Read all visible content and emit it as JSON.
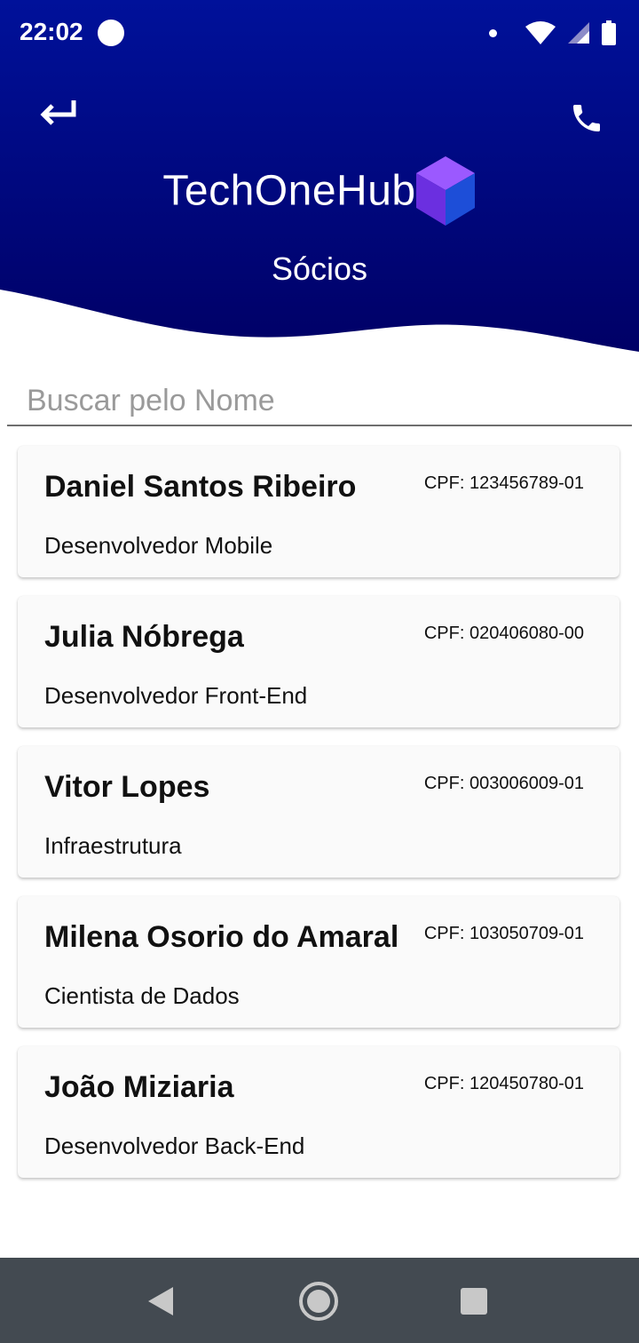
{
  "status_bar": {
    "time": "22:02"
  },
  "header": {
    "brand_name": "TechOneHub",
    "subtitle": "Sócios",
    "gradient_top": "#00119a",
    "gradient_bottom": "#000066"
  },
  "icons": {
    "back": "return-arrow-icon",
    "phone": "phone-icon",
    "logo": "cube-logo-icon"
  },
  "search": {
    "placeholder": "Buscar pelo Nome",
    "value": ""
  },
  "partners": [
    {
      "name": "Daniel Santos Ribeiro",
      "cpf": "CPF: 123456789-01",
      "role": "Desenvolvedor Mobile"
    },
    {
      "name": "Julia Nóbrega",
      "cpf": "CPF: 020406080-00",
      "role": "Desenvolvedor Front-End"
    },
    {
      "name": "Vitor Lopes",
      "cpf": "CPF: 003006009-01",
      "role": "Infraestrutura"
    },
    {
      "name": "Milena Osorio do Amaral",
      "cpf": "CPF: 103050709-01",
      "role": "Cientista de Dados"
    },
    {
      "name": "João Miziaria",
      "cpf": "CPF: 120450780-01",
      "role": "Desenvolvedor Back-End"
    }
  ],
  "nav_bar": {
    "color": "#434a51"
  }
}
